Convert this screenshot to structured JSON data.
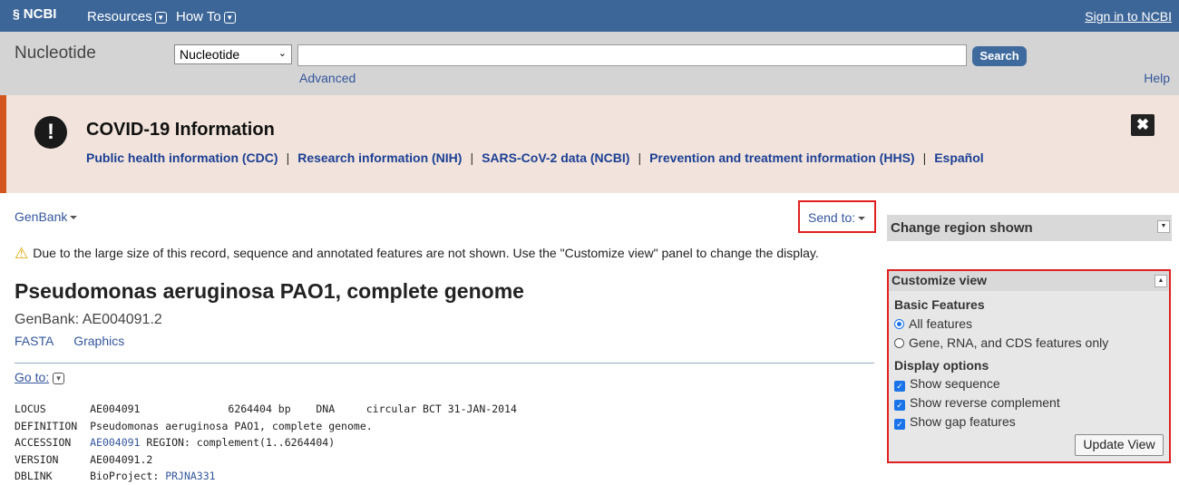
{
  "topbar": {
    "logo": "NCBI",
    "nav": [
      "Resources",
      "How To"
    ],
    "signin": "Sign in to NCBI"
  },
  "search": {
    "db_name": "Nucleotide",
    "db_selected": "Nucleotide",
    "query_value": "",
    "button": "Search",
    "advanced": "Advanced",
    "help": "Help"
  },
  "covid": {
    "title": "COVID-19 Information",
    "links": [
      "Public health information (CDC)",
      "Research information (NIH)",
      "SARS-CoV-2 data (NCBI)",
      "Prevention and treatment information (HHS)",
      "Español"
    ],
    "separator": "|"
  },
  "main": {
    "format": "GenBank",
    "send_to": "Send to:",
    "warning": "Due to the large size of this record, sequence and annotated features are not shown. Use the \"Customize view\" panel to change the display.",
    "title": "Pseudomonas aeruginosa PAO1, complete genome",
    "genbank_id": "GenBank: AE004091.2",
    "links": [
      "FASTA",
      "Graphics"
    ],
    "goto": "Go to:",
    "record": {
      "locus_key": "LOCUS",
      "locus_val": "AE004091              6264404 bp    DNA     circular BCT 31-JAN-2014",
      "def_key": "DEFINITION",
      "def_val": "Pseudomonas aeruginosa PAO1, complete genome.",
      "acc_key": "ACCESSION",
      "acc_link": "AE004091",
      "acc_rest": " REGION: complement(1..6264404)",
      "ver_key": "VERSION",
      "ver_val": "AE004091.2",
      "dblink_key": "DBLINK",
      "dblink_val": "BioProject: ",
      "dblink_link": "PRJNA331"
    }
  },
  "sidebar": {
    "change_region": "Change region shown",
    "customize": {
      "title": "Customize view",
      "basic_features": "Basic Features",
      "opt_all": "All features",
      "opt_gene": "Gene, RNA, and CDS features only",
      "display_options": "Display options",
      "show_sequence": "Show sequence",
      "show_revcomp": "Show reverse complement",
      "show_gap": "Show gap features",
      "update": "Update View"
    }
  }
}
